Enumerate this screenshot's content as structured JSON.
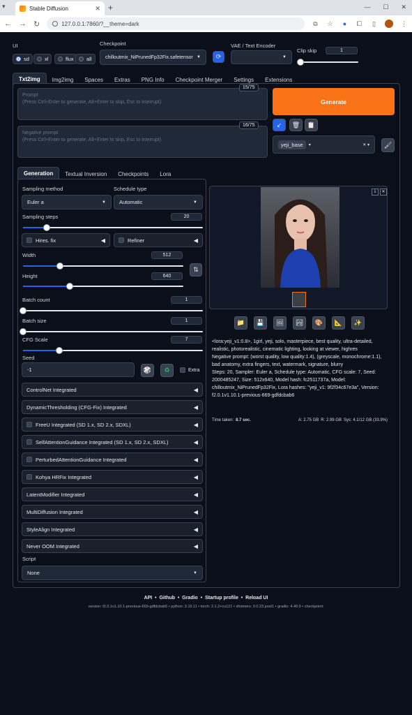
{
  "browser": {
    "tab_title": "Stable Diffusion",
    "url": "127.0.0.1:7860/?__theme=dark"
  },
  "top": {
    "ui_label": "UI",
    "ui_options": [
      "sd",
      "xl",
      "flux",
      "all"
    ],
    "ui_selected": "sd",
    "checkpoint_label": "Checkpoint",
    "checkpoint_value": "chilloutmix_NiPrunedFp32Fix.safetensor",
    "vae_label": "VAE / Text Encoder",
    "vae_value": "",
    "clip_label": "Clip skip",
    "clip_value": "1"
  },
  "main_tabs": [
    "Txt2img",
    "Img2img",
    "Spaces",
    "Extras",
    "PNG Info",
    "Checkpoint Merger",
    "Settings",
    "Extensions"
  ],
  "prompt": {
    "placeholder_title": "Prompt",
    "placeholder_hint": "(Press Ctrl+Enter to generate, Alt+Enter to skip, Esc to interrupt)",
    "counter": "15/75"
  },
  "neg_prompt": {
    "placeholder_title": "Negative prompt",
    "placeholder_hint": "(Press Ctrl+Enter to generate, Alt+Enter to skip, Esc to interrupt)",
    "counter": "16/75"
  },
  "generate_label": "Generate",
  "style_value": "yeji_base",
  "sub_tabs": [
    "Generation",
    "Textual Inversion",
    "Checkpoints",
    "Lora"
  ],
  "params": {
    "sampling_method_label": "Sampling method",
    "sampling_method": "Euler a",
    "schedule_label": "Schedule type",
    "schedule": "Automatic",
    "steps_label": "Sampling steps",
    "steps": "20",
    "steps_frac": 0.13,
    "hires_label": "Hires. fix",
    "refiner_label": "Refiner",
    "width_label": "Width",
    "width": "512",
    "width_frac": 0.23,
    "height_label": "Height",
    "height": "640",
    "height_frac": 0.29,
    "batch_count_label": "Batch count",
    "batch_count": "1",
    "batch_count_frac": 0.0,
    "batch_size_label": "Batch size",
    "batch_size": "1",
    "batch_size_frac": 0.0,
    "cfg_label": "CFG Scale",
    "cfg": "7",
    "cfg_frac": 0.2,
    "seed_label": "Seed",
    "seed": "-1",
    "extra_label": "Extra"
  },
  "accordions": [
    {
      "label": "ControlNet Integrated",
      "check": false
    },
    {
      "label": "DynamicThresholding (CFG-Fix) Integrated",
      "check": false
    },
    {
      "label": "FreeU Integrated (SD 1.x, SD 2.x, SDXL)",
      "check": true
    },
    {
      "label": "SelfAttentionGuidance Integrated (SD 1.x, SD 2.x, SDXL)",
      "check": true
    },
    {
      "label": "PerturbedAttentionGuidance Integrated",
      "check": true
    },
    {
      "label": "Kohya HRFix Integrated",
      "check": true
    },
    {
      "label": "LatentModifier Integrated",
      "check": false
    },
    {
      "label": "MultiDiffusion Integrated",
      "check": false
    },
    {
      "label": "StyleAlign Integrated",
      "check": false
    },
    {
      "label": "Never OOM Integrated",
      "check": false
    }
  ],
  "script": {
    "label": "Script",
    "value": "None"
  },
  "output": {
    "info_lines": [
      "<lora:yeji_v1:0.8>, 1girl, yeji, solo, masterpiece, best quality, ultra-detailed, realistic, photorealistic, cinematic lighting, looking at viewer, highres",
      "Negative prompt: (worst quality, low quality:1.4), (greyscale, monochrome:1.1), bad anatomy, extra fingers, text, watermark, signature, blurry",
      "Steps: 20, Sampler: Euler a, Schedule type: Automatic, CFG scale: 7, Seed: 2000485247, Size: 512x640, Model hash: fc2511737a, Model: chilloutmix_NiPrunedFp32Fix, Lora hashes: \"yeji_v1: 9f2f34c67e3a\", Version: f2.0.1v1.10.1-previous-669-gdfdcbab6"
    ],
    "time_label": "Time taken:",
    "time_value": "8.7 sec.",
    "mem_a": "A: 2.75 GB",
    "mem_r": "R: 2.99 GB",
    "mem_sys": "Sys: 4.1/12 GB (33.9%)"
  },
  "footer": {
    "links": [
      "API",
      "Github",
      "Gradio",
      "Startup profile",
      "Reload UI"
    ],
    "version": "version: f2.0.1v1.10.1-previous-669-gdfdcbab6  •  python: 3.10.11  •  torch: 2.1.2+cu121  •  xformers: 0.0.23.post1  •  gradio: 4.40.0  •  checkpoint:"
  }
}
